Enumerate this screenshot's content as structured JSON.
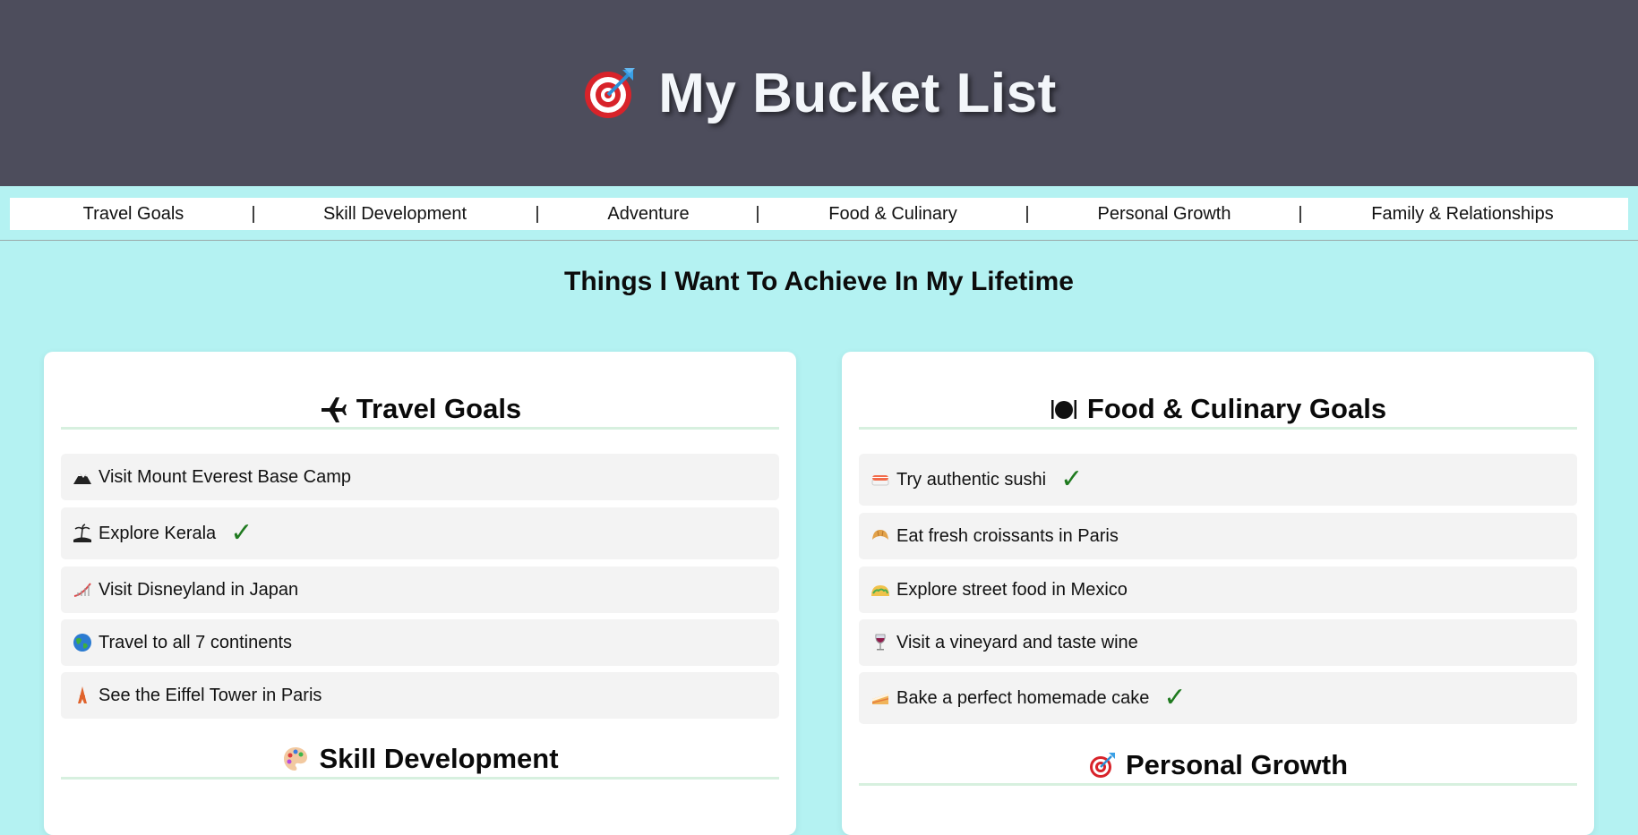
{
  "header": {
    "title": "My Bucket List",
    "icon": "target-dart-icon"
  },
  "nav": {
    "items": [
      {
        "label": "Travel Goals"
      },
      {
        "label": "Skill Development"
      },
      {
        "label": "Adventure"
      },
      {
        "label": "Food & Culinary"
      },
      {
        "label": "Personal Growth"
      },
      {
        "label": "Family & Relationships"
      }
    ],
    "separator": "|"
  },
  "page_heading": "Things I Want To Achieve In My Lifetime",
  "cards": [
    {
      "sections": [
        {
          "title": "Travel Goals",
          "icon": "airplane-icon",
          "items": [
            {
              "text": "Visit Mount Everest Base Camp",
              "icon": "mountain-icon",
              "done": false
            },
            {
              "text": "Explore Kerala",
              "icon": "island-icon",
              "done": true
            },
            {
              "text": "Visit Disneyland in Japan",
              "icon": "roller-coaster-icon",
              "done": false
            },
            {
              "text": "Travel to all 7 continents",
              "icon": "globe-icon",
              "done": false
            },
            {
              "text": "See the Eiffel Tower in Paris",
              "icon": "tower-icon",
              "done": false
            }
          ]
        },
        {
          "title": "Skill Development",
          "icon": "palette-icon",
          "items": []
        }
      ]
    },
    {
      "sections": [
        {
          "title": "Food & Culinary Goals",
          "icon": "plate-cutlery-icon",
          "items": [
            {
              "text": "Try authentic sushi",
              "icon": "sushi-icon",
              "done": true
            },
            {
              "text": "Eat fresh croissants in Paris",
              "icon": "croissant-icon",
              "done": false
            },
            {
              "text": "Explore street food in Mexico",
              "icon": "taco-icon",
              "done": false
            },
            {
              "text": "Visit a vineyard and taste wine",
              "icon": "wine-glass-icon",
              "done": false
            },
            {
              "text": "Bake a perfect homemade cake",
              "icon": "cake-icon",
              "done": true
            }
          ]
        },
        {
          "title": "Personal Growth",
          "icon": "target-dart-icon",
          "items": []
        }
      ]
    }
  ],
  "check_mark": "✓",
  "colors": {
    "header_bg": "#4d4d5c",
    "page_bg": "#b4f2f2",
    "check": "#1f7a1f",
    "rule": "#d7f0df",
    "item_bg": "#f3f3f3"
  }
}
